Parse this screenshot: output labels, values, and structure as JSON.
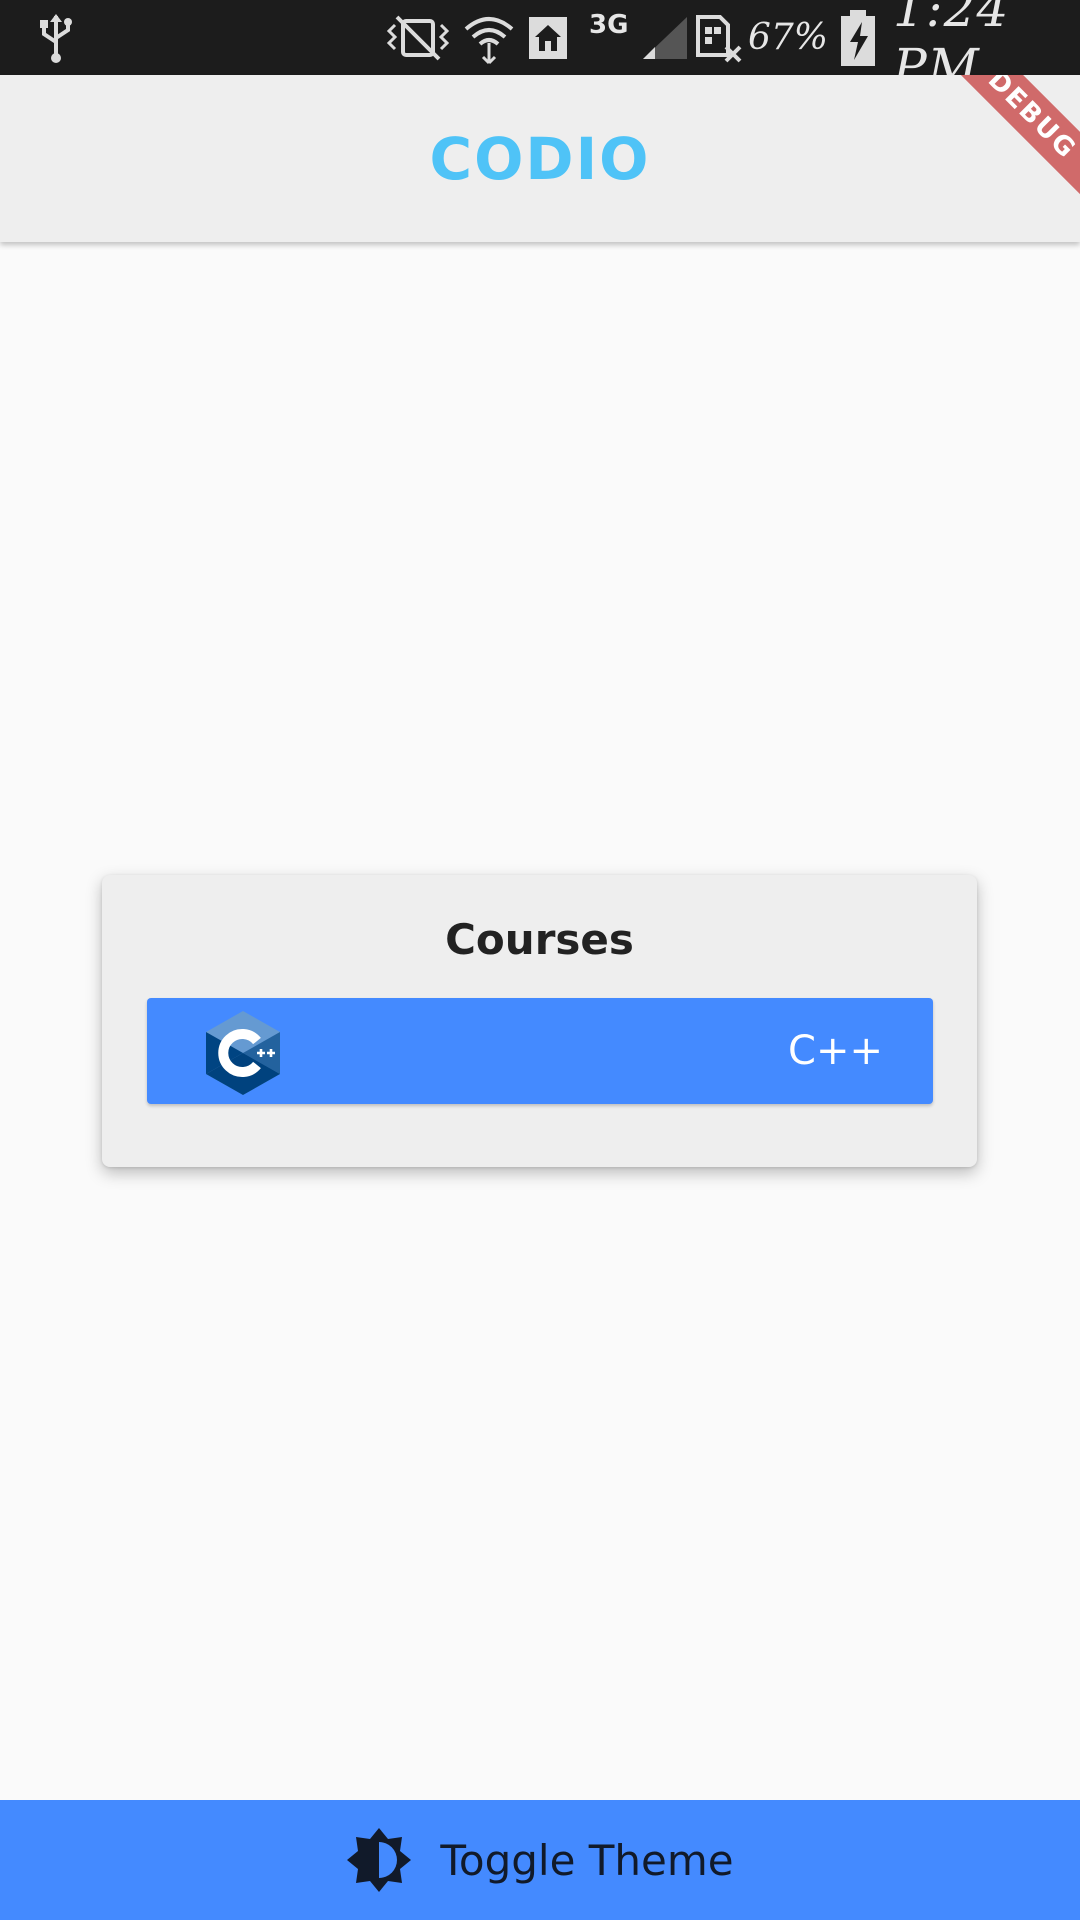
{
  "status_bar": {
    "network_type": "3G",
    "battery_percent": "67%",
    "time": "1:24 PM",
    "icons": [
      "usb-icon",
      "vibrate-icon",
      "wifi-icon",
      "home-icon",
      "network-3g-icon",
      "signal-icon",
      "no-sim-icon",
      "battery-charging-icon"
    ]
  },
  "app_bar": {
    "title": "CODIO",
    "title_color": "#4fc3f7",
    "debug_banner": "DEBUG"
  },
  "courses": {
    "title": "Courses",
    "items": [
      {
        "name": "C++",
        "icon": "cpp-logo-icon",
        "color": "#448aff"
      }
    ]
  },
  "toggle_theme": {
    "label": "Toggle Theme",
    "icon": "brightness-icon",
    "color": "#448aff"
  }
}
